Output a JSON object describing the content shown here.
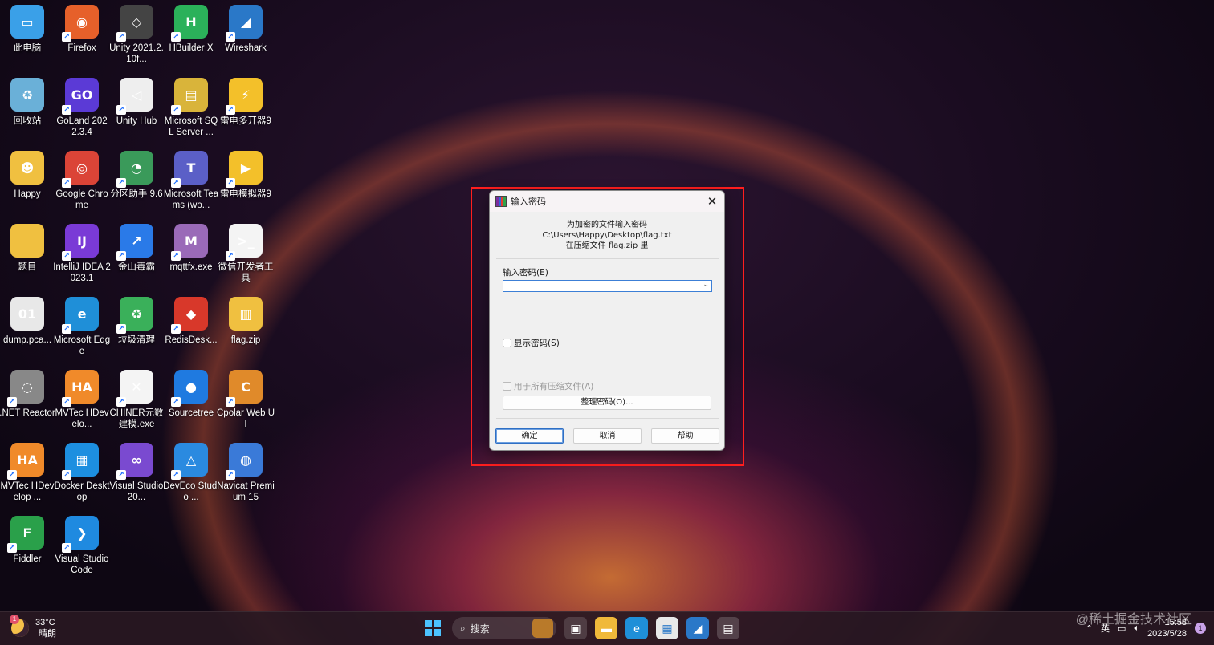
{
  "desktop": {
    "icons": [
      {
        "label": "此电脑",
        "icon": "computer-icon",
        "color": "#3aa0e8",
        "glyph": "▭"
      },
      {
        "label": "Firefox",
        "icon": "firefox-icon",
        "color": "#e6602a",
        "glyph": "◉"
      },
      {
        "label": "Unity 2021.2.10f...",
        "icon": "unity-icon",
        "color": "#444444",
        "glyph": "◇"
      },
      {
        "label": "HBuilder X",
        "icon": "hbuilder-icon",
        "color": "#2bb15a",
        "glyph": "H"
      },
      {
        "label": "Wireshark",
        "icon": "wireshark-icon",
        "color": "#2a78c8",
        "glyph": "◢"
      },
      {
        "label": "回收站",
        "icon": "recycle-bin-icon",
        "color": "#6ab0d8",
        "glyph": "♻"
      },
      {
        "label": "GoLand 2022.3.4",
        "icon": "goland-icon",
        "color": "#5b3ad6",
        "glyph": "GO"
      },
      {
        "label": "Unity Hub",
        "icon": "unity-hub-icon",
        "color": "#eeeeee",
        "glyph": "◁"
      },
      {
        "label": "Microsoft SQL Server ...",
        "icon": "sql-server-icon",
        "color": "#d9b43a",
        "glyph": "▤"
      },
      {
        "label": "雷电多开器9",
        "icon": "ldmulti-icon",
        "color": "#f3c02a",
        "glyph": "⚡"
      },
      {
        "label": "Happy",
        "icon": "user-folder-icon",
        "color": "#f0c040",
        "glyph": "☻"
      },
      {
        "label": "Google Chrome",
        "icon": "chrome-icon",
        "color": "#db4437",
        "glyph": "◎"
      },
      {
        "label": "分区助手 9.6",
        "icon": "partition-icon",
        "color": "#3a9a5a",
        "glyph": "◔"
      },
      {
        "label": "Microsoft Teams (wo...",
        "icon": "teams-icon",
        "color": "#5b5fc7",
        "glyph": "T"
      },
      {
        "label": "雷电模拟器9",
        "icon": "ldplayer-icon",
        "color": "#f3c02a",
        "glyph": "▶"
      },
      {
        "label": "题目",
        "icon": "folder-icon",
        "color": "#f0c040",
        "glyph": ""
      },
      {
        "label": "IntelliJ IDEA 2023.1",
        "icon": "intellij-icon",
        "color": "#7a3ad6",
        "glyph": "IJ"
      },
      {
        "label": "金山毒霸",
        "icon": "antivirus-icon",
        "color": "#2a7ae8",
        "glyph": "↗"
      },
      {
        "label": "mqttfx.exe",
        "icon": "mqtt-icon",
        "color": "#9a6ab8",
        "glyph": "M"
      },
      {
        "label": "微信开发者工具",
        "icon": "wechat-dev-icon",
        "color": "#f4f4f4",
        "glyph": ">_"
      },
      {
        "label": "dump.pca...",
        "icon": "binary-file-icon",
        "color": "#e8e8e8",
        "glyph": "01"
      },
      {
        "label": "Microsoft Edge",
        "icon": "edge-icon",
        "color": "#1f8fd8",
        "glyph": "e"
      },
      {
        "label": "垃圾清理",
        "icon": "cleaner-icon",
        "color": "#3ab05a",
        "glyph": "♻"
      },
      {
        "label": "RedisDesk...",
        "icon": "redis-icon",
        "color": "#d8382a",
        "glyph": "◆"
      },
      {
        "label": "flag.zip",
        "icon": "zip-folder-icon",
        "color": "#f0c040",
        "glyph": "▥"
      },
      {
        "label": ".NET Reactor",
        "icon": "net-reactor-icon",
        "color": "#888888",
        "glyph": "◌"
      },
      {
        "label": "MVTec HDevelo...",
        "icon": "mvtec-icon",
        "color": "#f08a2a",
        "glyph": "HA"
      },
      {
        "label": "CHINER元数建模.exe",
        "icon": "chiner-icon",
        "color": "#f4f4f4",
        "glyph": "✕"
      },
      {
        "label": "Sourcetree",
        "icon": "sourcetree-icon",
        "color": "#1f7ae0",
        "glyph": "●"
      },
      {
        "label": "Cpolar Web UI",
        "icon": "cpolar-icon",
        "color": "#e08a2a",
        "glyph": "C"
      },
      {
        "label": "MVTec HDevelop ...",
        "icon": "mvtec-icon",
        "color": "#f08a2a",
        "glyph": "HA"
      },
      {
        "label": "Docker Desktop",
        "icon": "docker-icon",
        "color": "#1d8fe0",
        "glyph": "▦"
      },
      {
        "label": "Visual Studio 20...",
        "icon": "visual-studio-icon",
        "color": "#7a4ad0",
        "glyph": "∞"
      },
      {
        "label": "DevEco Studio ...",
        "icon": "deveco-icon",
        "color": "#2a8ae0",
        "glyph": "△"
      },
      {
        "label": "Navicat Premium 15",
        "icon": "navicat-icon",
        "color": "#3a7ad8",
        "glyph": "◍"
      },
      {
        "label": "Fiddler",
        "icon": "fiddler-icon",
        "color": "#2aa04a",
        "glyph": "F"
      },
      {
        "label": "Visual Studio Code",
        "icon": "vscode-icon",
        "color": "#1f8ae0",
        "glyph": "❯"
      }
    ]
  },
  "dialog": {
    "title": "输入密码",
    "info_line1": "为加密的文件输入密码",
    "info_line2": "C:\\Users\\Happy\\Desktop\\flag.txt",
    "info_line3": "在压缩文件 flag.zip 里",
    "password_label": "输入密码(E)",
    "password_value": "",
    "show_password_label": "显示密码(S)",
    "all_archives_label": "用于所有压缩文件(A)",
    "manage_button": "整理密码(O)...",
    "ok_button": "确定",
    "cancel_button": "取消",
    "help_button": "帮助",
    "close_symbol": "✕"
  },
  "taskbar": {
    "temperature": "33°C",
    "weather": "晴朗",
    "weather_badge": "1",
    "search_label": "搜索",
    "input_method": "英",
    "time": "15:58",
    "date": "2023/5/28",
    "notification_count": "1"
  },
  "watermark": "@稀土掘金技术社区",
  "colors": {
    "highlight": "#ff1e1e",
    "primary_button_border": "#2f6fc4"
  }
}
